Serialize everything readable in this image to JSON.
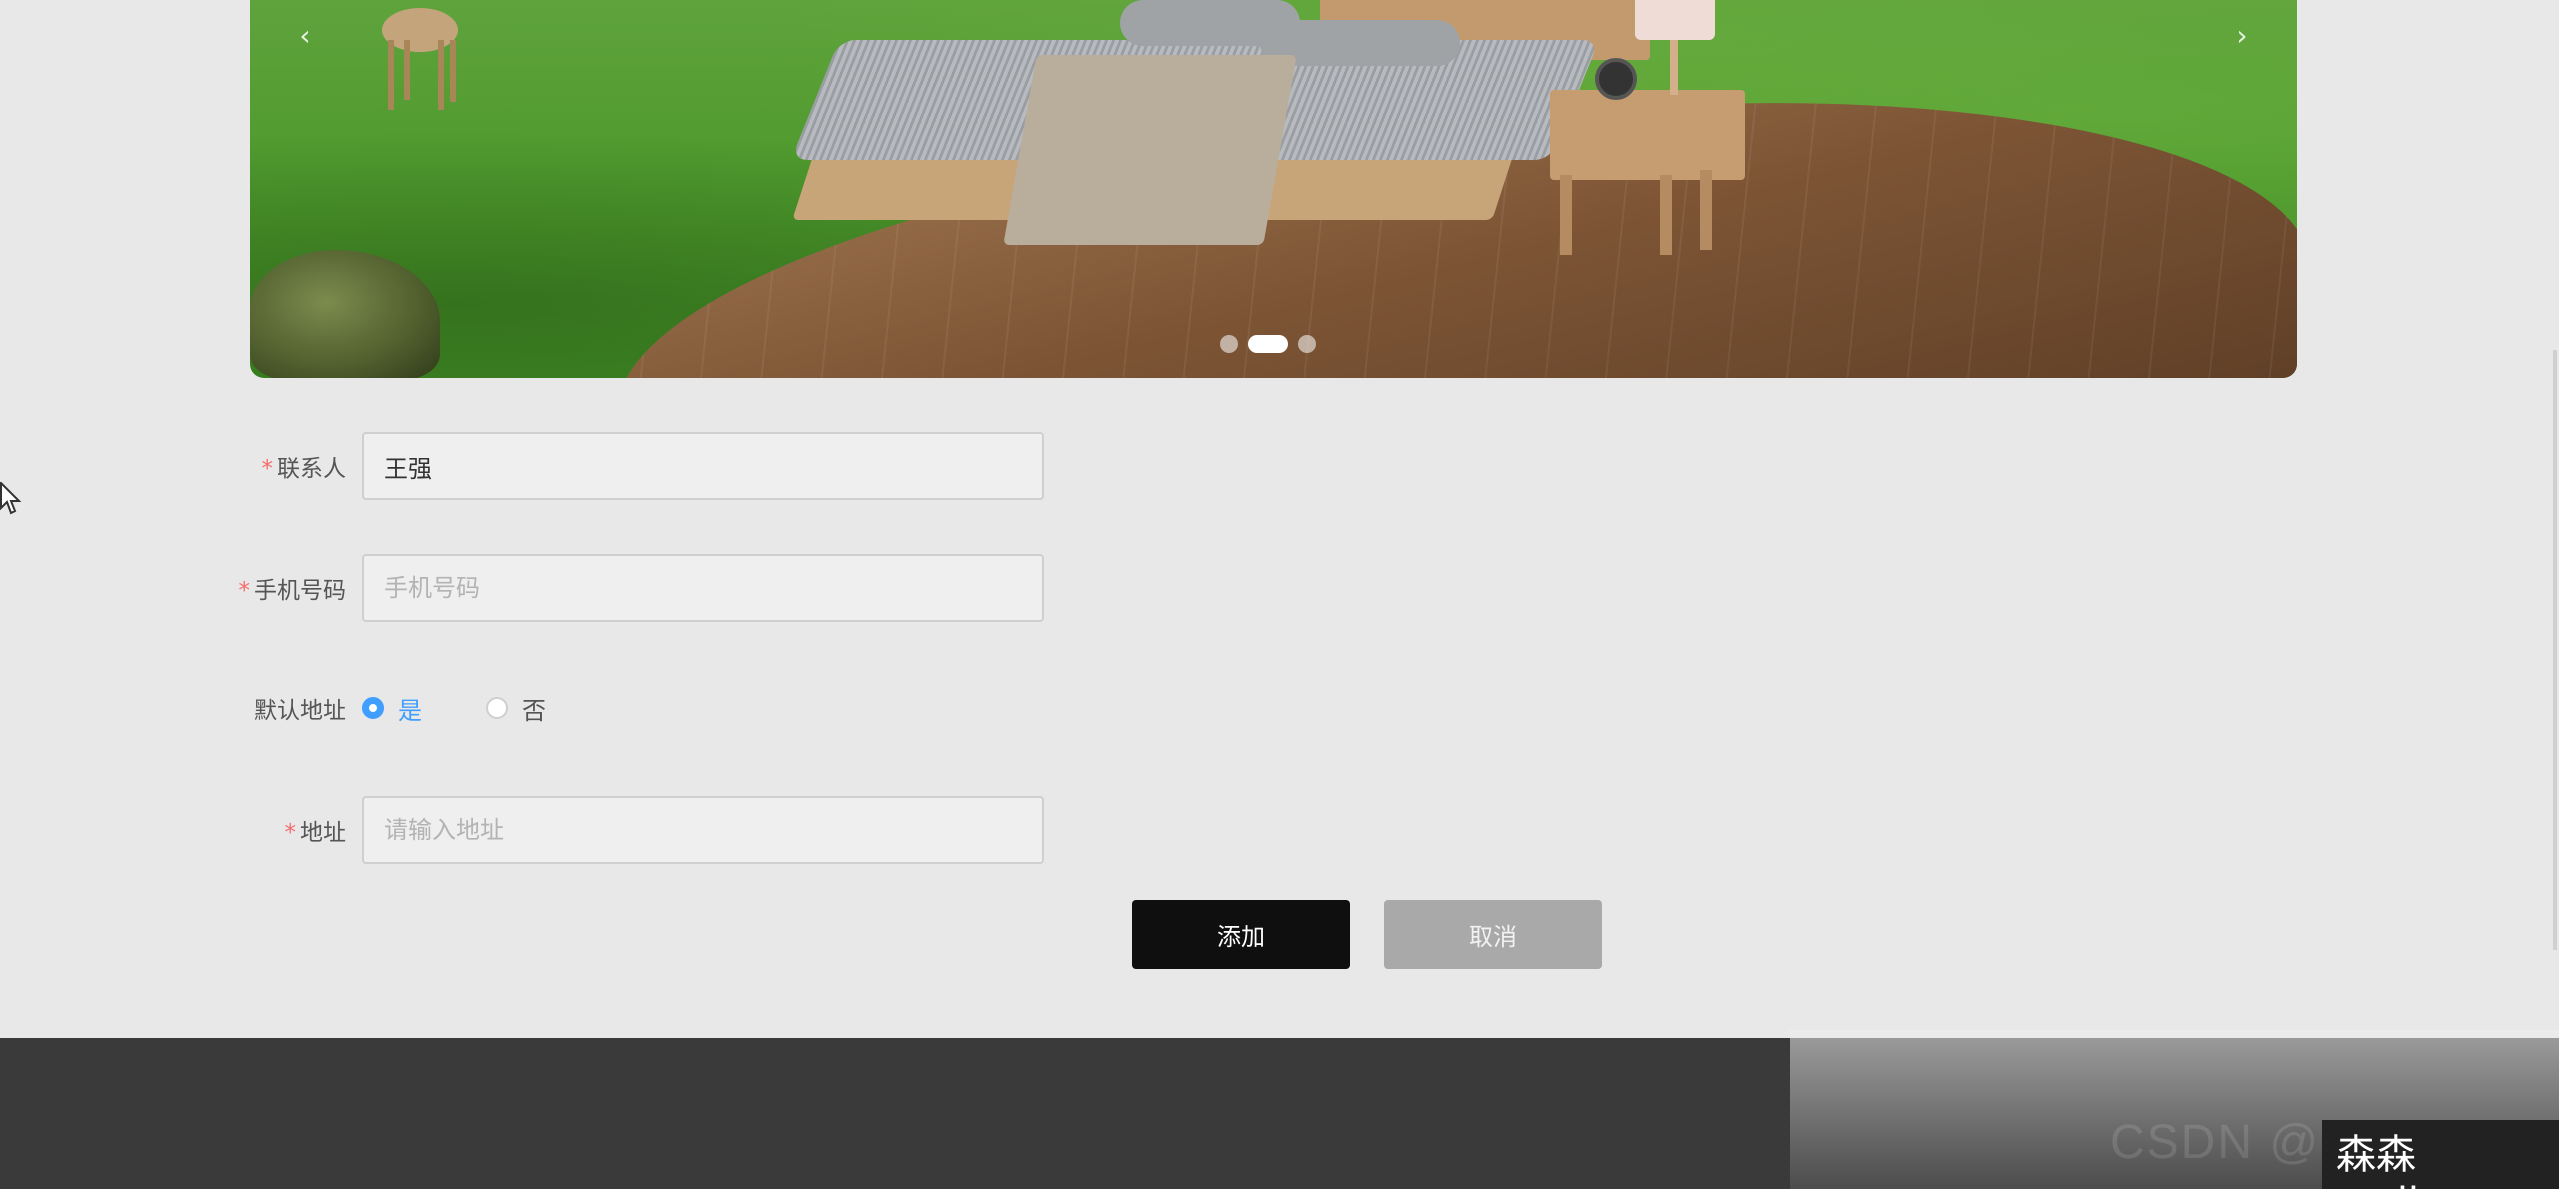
{
  "carousel": {
    "prev_icon": "‹",
    "next_icon": "›",
    "slide_count": 3,
    "active_slide": 2
  },
  "form": {
    "contact": {
      "label": "联系人",
      "required_mark": "*",
      "value": "王强",
      "placeholder": ""
    },
    "phone": {
      "label": "手机号码",
      "required_mark": "*",
      "value": "",
      "placeholder": "手机号码"
    },
    "default_address": {
      "label": "默认地址",
      "options": [
        {
          "label": "是",
          "checked": true
        },
        {
          "label": "否",
          "checked": false
        }
      ]
    },
    "address": {
      "label": "地址",
      "required_mark": "*",
      "value": "",
      "placeholder": "请输入地址"
    }
  },
  "buttons": {
    "add_label": "添加",
    "cancel_label": "取消"
  },
  "overlay": {
    "watermark": "森森coding",
    "csdn_text": "CSDN @"
  },
  "colors": {
    "accent": "#409eff",
    "required": "#f56c6c",
    "add_button": "#0f0f0f",
    "cancel_button": "#a9a9a9",
    "footer": "#3a3a3a"
  }
}
